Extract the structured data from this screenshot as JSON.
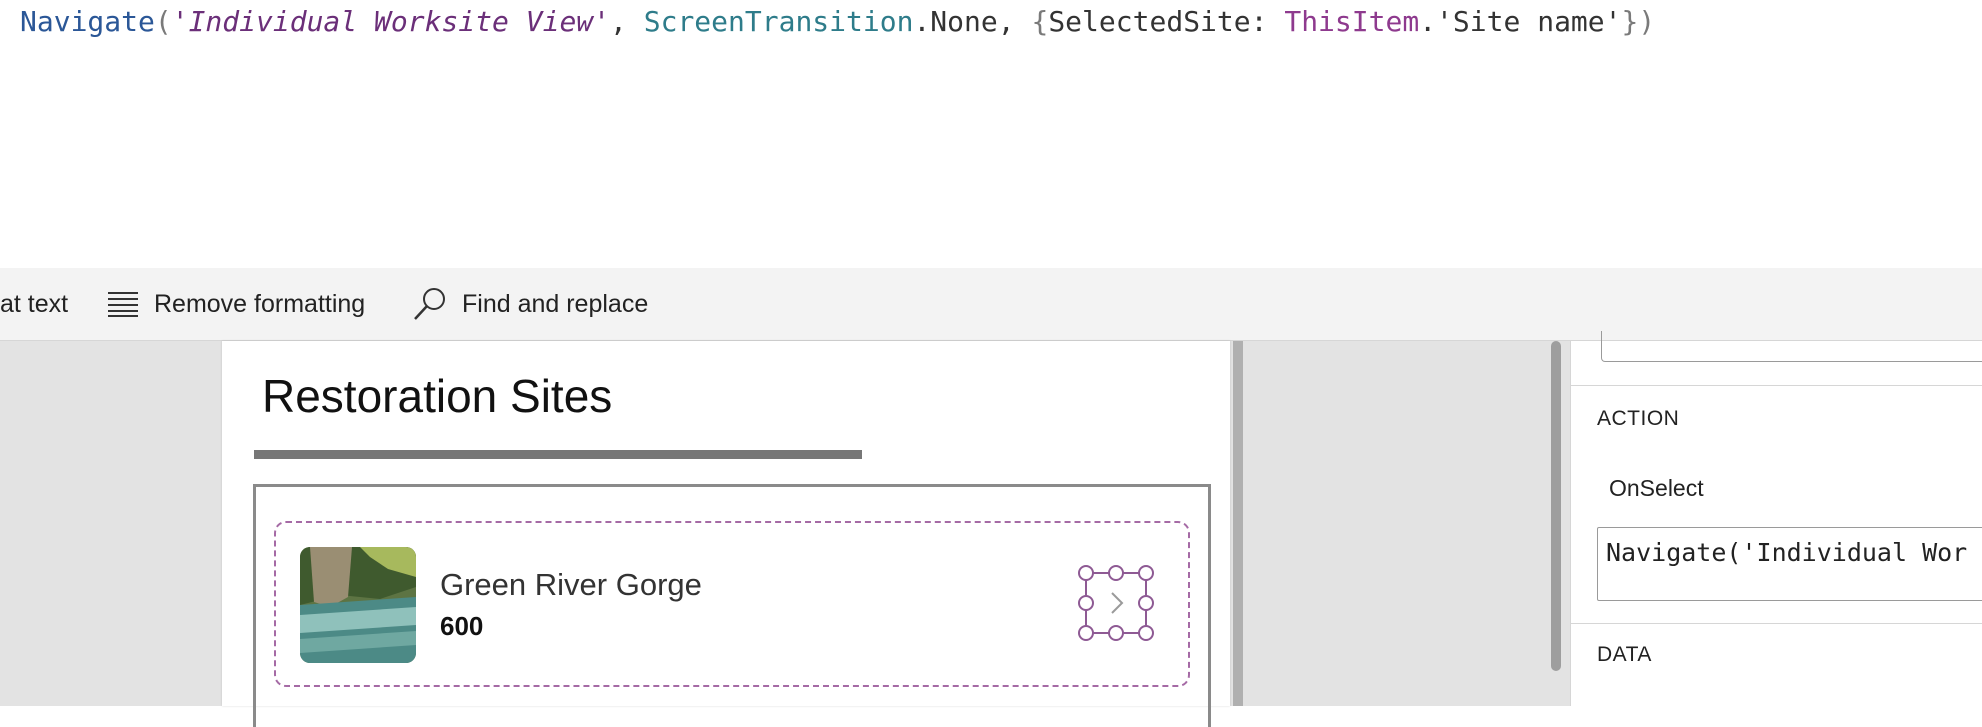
{
  "formula": {
    "fn": "Navigate",
    "open_paren": "(",
    "arg1": "'Individual Worksite View'",
    "comma1": ", ",
    "enum_name": "ScreenTransition",
    "enum_value": ".None",
    "comma2": ", ",
    "open_brace": "{",
    "record_key": "SelectedSite: ",
    "this_item": "ThisItem",
    "field": ".'Site name'",
    "close": "})"
  },
  "toolbar": {
    "format_text_label": "at text",
    "remove_formatting_label": "Remove formatting",
    "find_replace_label": "Find and replace"
  },
  "screen": {
    "title": "Restoration Sites",
    "gallery_items": [
      {
        "title": "Green River Gorge",
        "subtitle": "600"
      }
    ]
  },
  "properties": {
    "action_section": "ACTION",
    "onselect_label": "OnSelect",
    "onselect_value": "Navigate('Individual Wor",
    "data_section": "DATA"
  },
  "colors": {
    "selection_purple": "#8e5a94",
    "function_blue": "#2b5797",
    "enum_teal": "#2e7c8a"
  }
}
